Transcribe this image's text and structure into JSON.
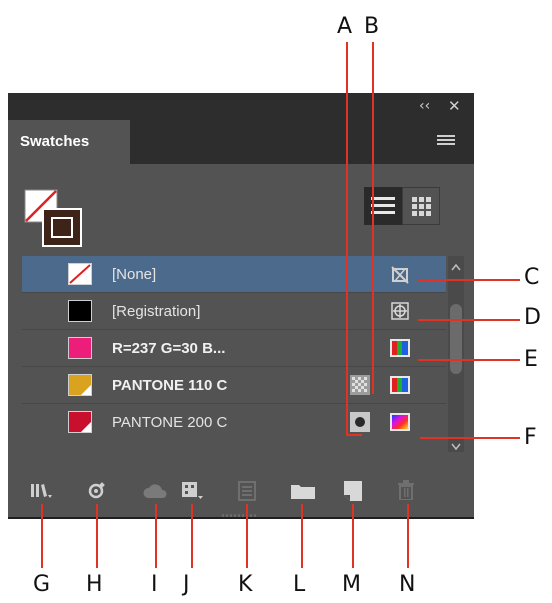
{
  "panel": {
    "tab_label": "Swatches",
    "controls": {
      "collapse": "‹‹",
      "close": "✕"
    }
  },
  "swatches": [
    {
      "name": "[None]",
      "chip": "none",
      "selected": true
    },
    {
      "name": "[Registration]",
      "chip": "#000000",
      "selected": false
    },
    {
      "name": "R=237 G=30 B...",
      "chip": "#ed1e79",
      "selected": false
    },
    {
      "name": "PANTONE 110 C",
      "chip": "#d9a320",
      "selected": false
    },
    {
      "name": "PANTONE 200 C",
      "chip": "#c8102e",
      "selected": false
    }
  ],
  "toolbar_icons": [
    "library-icon",
    "color-picker-icon",
    "cloud-upload-icon",
    "swatch-views-icon",
    "swatch-options-icon",
    "new-folder-icon",
    "new-swatch-icon",
    "delete-icon"
  ],
  "callouts": {
    "top": [
      "A",
      "B"
    ],
    "right": [
      "C",
      "D",
      "E",
      "F"
    ],
    "bottom": [
      "G",
      "H",
      "I",
      "J",
      "K",
      "L",
      "M",
      "N"
    ]
  },
  "colors": {
    "panel_bg": "#535353",
    "selected_row": "#4b6a8c",
    "leader": "#e03326"
  }
}
